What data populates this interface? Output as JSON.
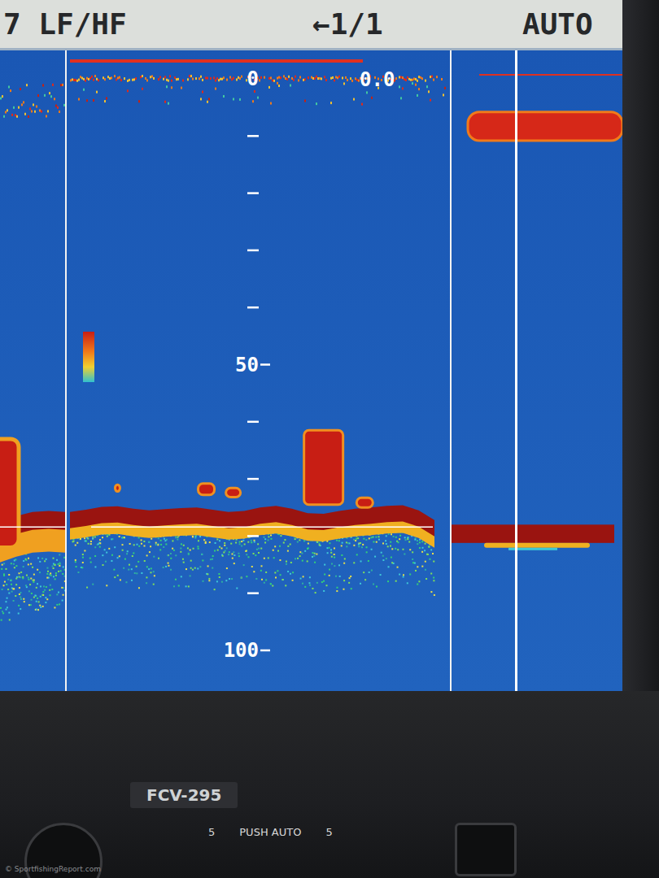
{
  "header": {
    "mode": "7 LF/HF",
    "page": "←1/1",
    "gain_mode": "AUTO"
  },
  "depth_scale": {
    "labels": [
      {
        "text": "0",
        "depth": 0
      },
      {
        "text": "50",
        "depth": 50
      },
      {
        "text": "100",
        "depth": 100
      }
    ],
    "ticks": [
      10,
      20,
      30,
      40,
      60,
      70,
      80,
      90
    ]
  },
  "readout": "0.0",
  "echogram": {
    "bottom_depth": [
      75.8,
      75.4,
      74.9,
      74.8,
      75.2,
      75.5,
      75.3,
      75.1,
      75.0,
      75.4,
      75.8,
      75.6,
      75.0,
      74.7,
      75.2,
      76.0,
      76.1,
      75.6,
      75.2,
      75.0,
      74.7,
      74.6,
      75.5,
      77.2
    ],
    "marker_depth": 78.4,
    "fish": [
      {
        "ping": 3.0,
        "depth_top": 71.0,
        "depth_bottom": 72.2,
        "width": 6
      },
      {
        "ping": 8.6,
        "depth_top": 70.8,
        "depth_bottom": 72.8,
        "width": 20
      },
      {
        "ping": 10.3,
        "depth_top": 71.6,
        "depth_bottom": 73.2,
        "width": 18
      },
      {
        "ping": 16.0,
        "depth_top": 61.5,
        "depth_bottom": 74.5,
        "width": 48
      },
      {
        "ping": 18.6,
        "depth_top": 73.3,
        "depth_bottom": 75.0,
        "width": 20
      }
    ]
  },
  "history": {
    "bottom_depth": [
      77.5,
      76.5,
      75.8,
      75.6,
      75.8
    ],
    "fish": [
      {
        "ping": 0.3,
        "depth_top": 63.0,
        "depth_bottom": 82.0,
        "width": 34
      }
    ]
  },
  "ascope": {
    "surface_top": 5.8,
    "surface_bottom": 10.8,
    "bottom_top": 78.0,
    "bottom_bottom": 81.2
  },
  "device": {
    "model": "FCV-295"
  },
  "controls": [
    {
      "label": "5"
    },
    {
      "label": "PUSH AUTO"
    },
    {
      "label": "5"
    }
  ],
  "watermark": "© SportfishingReport.com"
}
